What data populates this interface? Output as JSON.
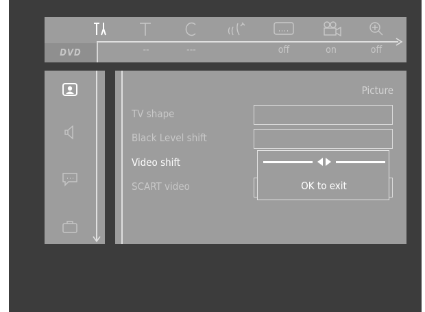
{
  "top_menu": {
    "icons": [
      "settings-tools-icon",
      "text-t-icon",
      "clock-c-icon",
      "sound-waves-icon",
      "subtitle-icon",
      "camera-angle-icon",
      "zoom-icon"
    ],
    "logo": "DVD",
    "values": [
      "--",
      "---",
      "off",
      "on",
      "off"
    ]
  },
  "sidebar": {
    "icons": [
      "person-picture-icon",
      "speaker-icon",
      "speech-bubble-icon",
      "briefcase-icon"
    ]
  },
  "panel": {
    "title": "Picture",
    "rows": [
      "TV shape",
      "Black Level shift",
      "Video shift",
      "SCART video"
    ],
    "popup_text": "OK to exit"
  },
  "colors": {
    "screen_bg": "#3c3c3c",
    "panel_bg": "#9d9d9d",
    "active_text": "#ffffff",
    "inactive_text": "#c8c8c8"
  }
}
